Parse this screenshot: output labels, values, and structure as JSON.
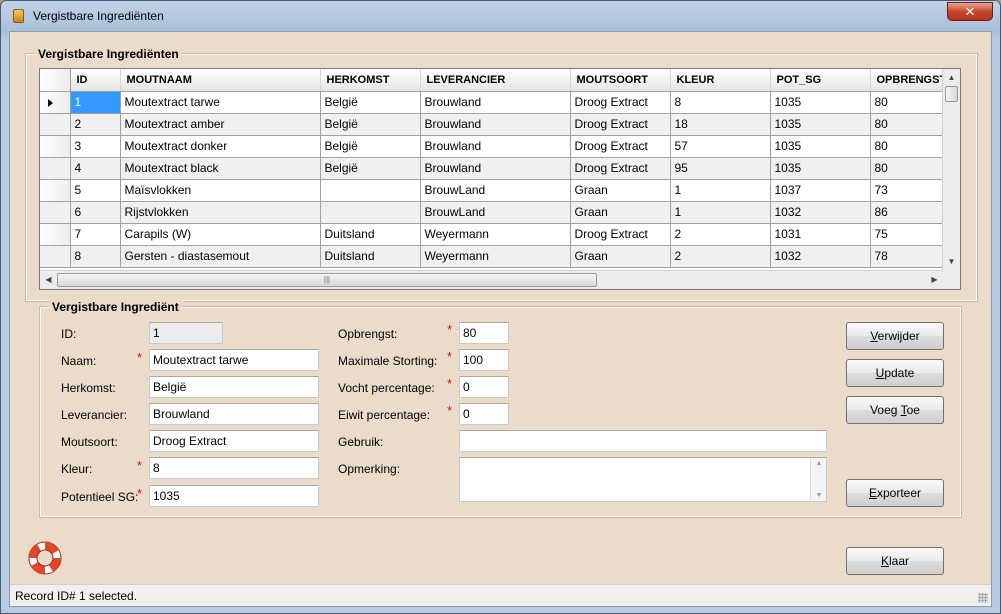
{
  "window": {
    "title": "Vergistbare Ingrediënten",
    "close_glyph": "✕"
  },
  "grid": {
    "group_title": "Vergistbare Ingrediënten",
    "columns": [
      "ID",
      "MOUTNAAM",
      "HERKOMST",
      "LEVERANCIER",
      "MOUTSOORT",
      "KLEUR",
      "POT_SG",
      "OPBRENGST"
    ],
    "rows": [
      [
        "1",
        "Moutextract tarwe",
        "België",
        "Brouwland",
        "Droog Extract",
        "8",
        "1035",
        "80"
      ],
      [
        "2",
        "Moutextract amber",
        "België",
        "Brouwland",
        "Droog Extract",
        "18",
        "1035",
        "80"
      ],
      [
        "3",
        "Moutextract donker",
        "België",
        "Brouwland",
        "Droog Extract",
        "57",
        "1035",
        "80"
      ],
      [
        "4",
        "Moutextract black",
        "België",
        "Brouwland",
        "Droog Extract",
        "95",
        "1035",
        "80"
      ],
      [
        "5",
        "Maïsvlokken",
        "",
        "BrouwLand",
        "Graan",
        "1",
        "1037",
        "73"
      ],
      [
        "6",
        "Rijstvlokken",
        "",
        "BrouwLand",
        "Graan",
        "1",
        "1032",
        "86"
      ],
      [
        "7",
        "Carapils (W)",
        "Duitsland",
        "Weyermann",
        "Droog Extract",
        "2",
        "1031",
        "75"
      ],
      [
        "8",
        "Gersten - diastasemout",
        "Duitsland",
        "Weyermann",
        "Graan",
        "2",
        "1032",
        "78"
      ]
    ],
    "selected_row": 0,
    "hscroll_grip": "|||"
  },
  "detail": {
    "group_title": "Vergistbare Ingrediënt",
    "labels": {
      "id": "ID:",
      "naam": "Naam:",
      "herkomst": "Herkomst:",
      "leverancier": "Leverancier:",
      "moutsoort": "Moutsoort:",
      "kleur": "Kleur:",
      "pot_sg": "Potentieel SG:",
      "opbrengst": "Opbrengst:",
      "max_storting": "Maximale Storting:",
      "vocht": "Vocht percentage:",
      "eiwit": "Eiwit percentage:",
      "gebruik": "Gebruik:",
      "opmerking": "Opmerking:"
    },
    "values": {
      "id": "1",
      "naam": "Moutextract tarwe",
      "herkomst": "België",
      "leverancier": "Brouwland",
      "moutsoort": "Droog Extract",
      "kleur": "8",
      "pot_sg": "1035",
      "opbrengst": "80",
      "max_storting": "100",
      "vocht": "0",
      "eiwit": "0",
      "gebruik": "",
      "opmerking": ""
    },
    "required_mark": "*"
  },
  "buttons": {
    "verwijder": "Verwijder",
    "update": "Update",
    "voeg_toe": "Voeg Toe",
    "exporteer": "Exporteer",
    "klaar": "Klaar"
  },
  "status": {
    "text": "Record ID# 1 selected."
  },
  "icons": {
    "app": "book-icon",
    "help": "lifebuoy-icon"
  }
}
